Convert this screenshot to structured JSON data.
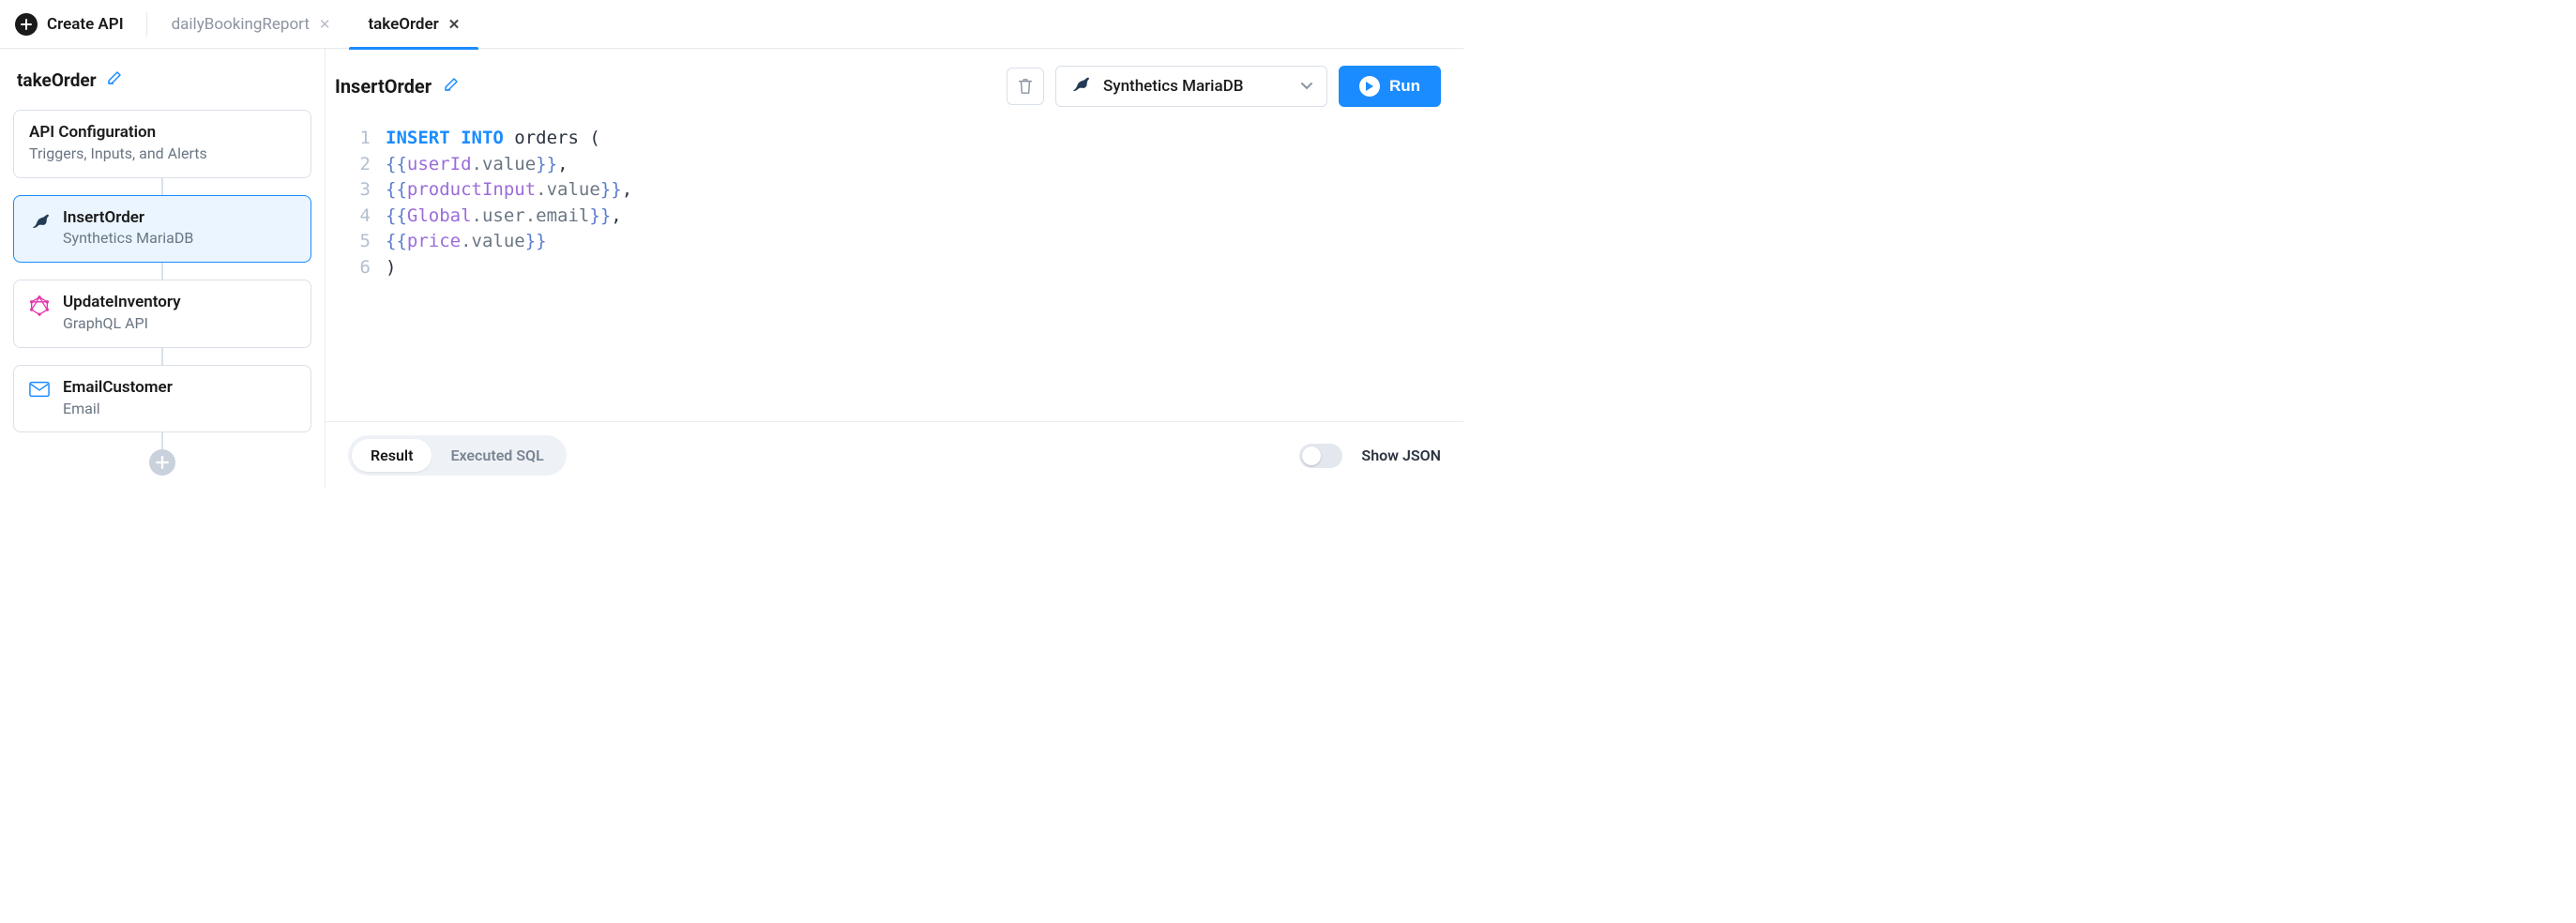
{
  "topbar": {
    "create_label": "Create API",
    "tabs": [
      {
        "label": "dailyBookingReport",
        "active": false
      },
      {
        "label": "takeOrder",
        "active": true
      }
    ]
  },
  "sidebar": {
    "workflow_name": "takeOrder",
    "nodes": [
      {
        "kind": "config",
        "title": "API Configuration",
        "subtitle": "Triggers, Inputs, and Alerts",
        "icon": null
      },
      {
        "kind": "step",
        "title": "InsertOrder",
        "subtitle": "Synthetics MariaDB",
        "icon": "mariadb",
        "selected": true
      },
      {
        "kind": "step",
        "title": "UpdateInventory",
        "subtitle": "GraphQL API",
        "icon": "graphql"
      },
      {
        "kind": "step",
        "title": "EmailCustomer",
        "subtitle": "Email",
        "icon": "email"
      }
    ]
  },
  "editor": {
    "step_name": "InsertOrder",
    "datasource": "Synthetics MariaDB",
    "run_label": "Run",
    "code_lines": [
      {
        "n": 1,
        "tokens": [
          {
            "t": "kw",
            "v": "INSERT INTO"
          },
          {
            "t": "plain",
            "v": " orders ("
          }
        ]
      },
      {
        "n": 2,
        "tokens": [
          {
            "t": "mustache",
            "ident": "userId",
            "member": ".value"
          },
          {
            "t": "plain",
            "v": ","
          }
        ]
      },
      {
        "n": 3,
        "tokens": [
          {
            "t": "mustache",
            "ident": "productInput",
            "member": ".value"
          },
          {
            "t": "plain",
            "v": ","
          }
        ]
      },
      {
        "n": 4,
        "tokens": [
          {
            "t": "mustache",
            "ident": "Global",
            "member": ".user.email"
          },
          {
            "t": "plain",
            "v": ","
          }
        ]
      },
      {
        "n": 5,
        "tokens": [
          {
            "t": "mustache",
            "ident": "price",
            "member": ".value"
          }
        ]
      },
      {
        "n": 6,
        "tokens": [
          {
            "t": "plain",
            "v": ")"
          }
        ]
      }
    ]
  },
  "results": {
    "tabs": [
      {
        "label": "Result",
        "active": true
      },
      {
        "label": "Executed SQL",
        "active": false
      }
    ],
    "show_json_label": "Show JSON",
    "show_json": false
  },
  "icons": {
    "plus": "plus-icon",
    "edit": "edit-pencil-icon",
    "trash": "trash-icon",
    "chevron_down": "chevron-down-icon",
    "play": "play-icon",
    "mariadb": "mariadb-icon",
    "graphql": "graphql-icon",
    "email": "email-icon",
    "add_step": "add-step-icon",
    "close": "close-icon"
  }
}
